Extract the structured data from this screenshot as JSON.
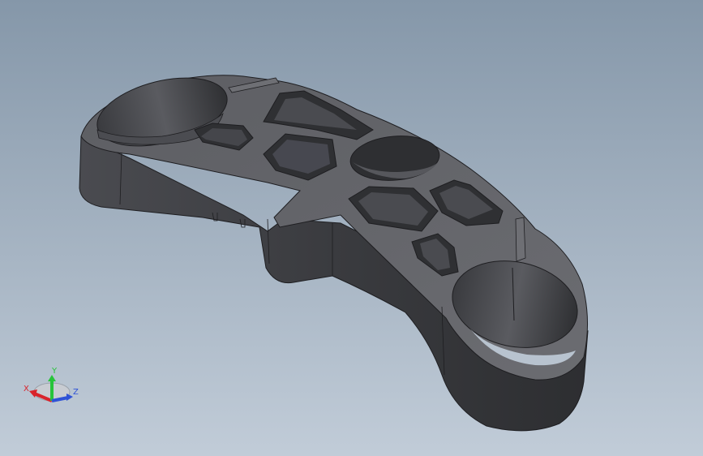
{
  "viewport": {
    "background_top": "#8597a9",
    "background_bottom": "#c1ccd8",
    "model_dark": "#3b3c40",
    "model_mid": "#57585d",
    "model_light": "#7a7b80",
    "edge_color": "#1e1e21"
  },
  "triad": {
    "x_label": "X",
    "y_label": "Y",
    "z_label": "Z",
    "x_color": "#d9232b",
    "y_color": "#27c43a",
    "z_color": "#2f52d6"
  }
}
